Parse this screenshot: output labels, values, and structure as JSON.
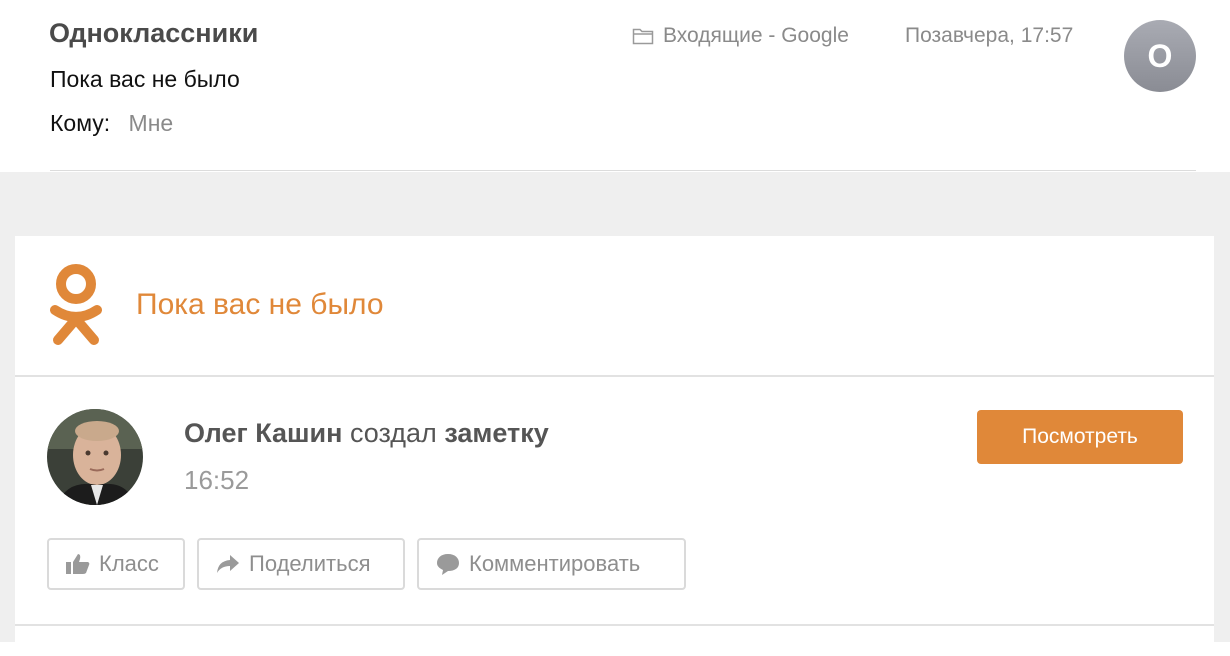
{
  "email": {
    "sender": "Одноклассники",
    "subject": "Пока вас не было",
    "to_label": "Кому:",
    "to_value": "Мне",
    "folder": "Входящие - Google",
    "date": "Позавчера, 17:57",
    "avatar_letter": "O"
  },
  "card": {
    "logo_icon": "odnoklassniki-logo-icon",
    "title": "Пока вас не было",
    "user_name": "Олег Кашин",
    "action_text": "создал",
    "object_text": "заметку",
    "time": "16:52",
    "view_button": "Посмотреть",
    "like_button": "Класс",
    "share_button": "Поделиться",
    "comment_button": "Комментировать"
  },
  "colors": {
    "accent": "#e08839",
    "background": "#efefef",
    "muted_text": "#8a8a8a"
  }
}
